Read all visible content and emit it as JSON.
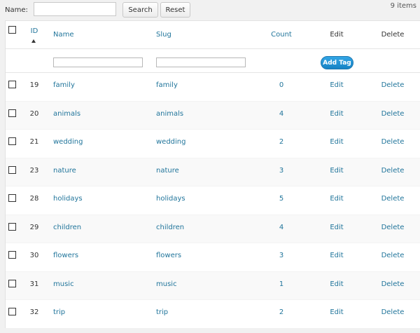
{
  "toolbar": {
    "name_label": "Name:",
    "name_value": "",
    "search_label": "Search",
    "reset_label": "Reset",
    "items_count": "9 items"
  },
  "table": {
    "headers": {
      "id": "ID",
      "name": "Name",
      "slug": "Slug",
      "count": "Count",
      "edit": "Edit",
      "delete": "Delete"
    },
    "filter": {
      "name_value": "",
      "slug_value": "",
      "add_tag_label": "Add Tag"
    },
    "rows": [
      {
        "id": "19",
        "name": "family",
        "slug": "family",
        "count": "0",
        "edit": "Edit",
        "delete": "Delete"
      },
      {
        "id": "20",
        "name": "animals",
        "slug": "animals",
        "count": "4",
        "edit": "Edit",
        "delete": "Delete"
      },
      {
        "id": "21",
        "name": "wedding",
        "slug": "wedding",
        "count": "2",
        "edit": "Edit",
        "delete": "Delete"
      },
      {
        "id": "23",
        "name": "nature",
        "slug": "nature",
        "count": "3",
        "edit": "Edit",
        "delete": "Delete"
      },
      {
        "id": "28",
        "name": "holidays",
        "slug": "holidays",
        "count": "5",
        "edit": "Edit",
        "delete": "Delete"
      },
      {
        "id": "29",
        "name": "children",
        "slug": "children",
        "count": "4",
        "edit": "Edit",
        "delete": "Delete"
      },
      {
        "id": "30",
        "name": "flowers",
        "slug": "flowers",
        "count": "3",
        "edit": "Edit",
        "delete": "Delete"
      },
      {
        "id": "31",
        "name": "music",
        "slug": "music",
        "count": "1",
        "edit": "Edit",
        "delete": "Delete"
      },
      {
        "id": "32",
        "name": "trip",
        "slug": "trip",
        "count": "2",
        "edit": "Edit",
        "delete": "Delete"
      }
    ]
  },
  "colors": {
    "link": "#21759b",
    "button_primary": "#1682c4"
  }
}
